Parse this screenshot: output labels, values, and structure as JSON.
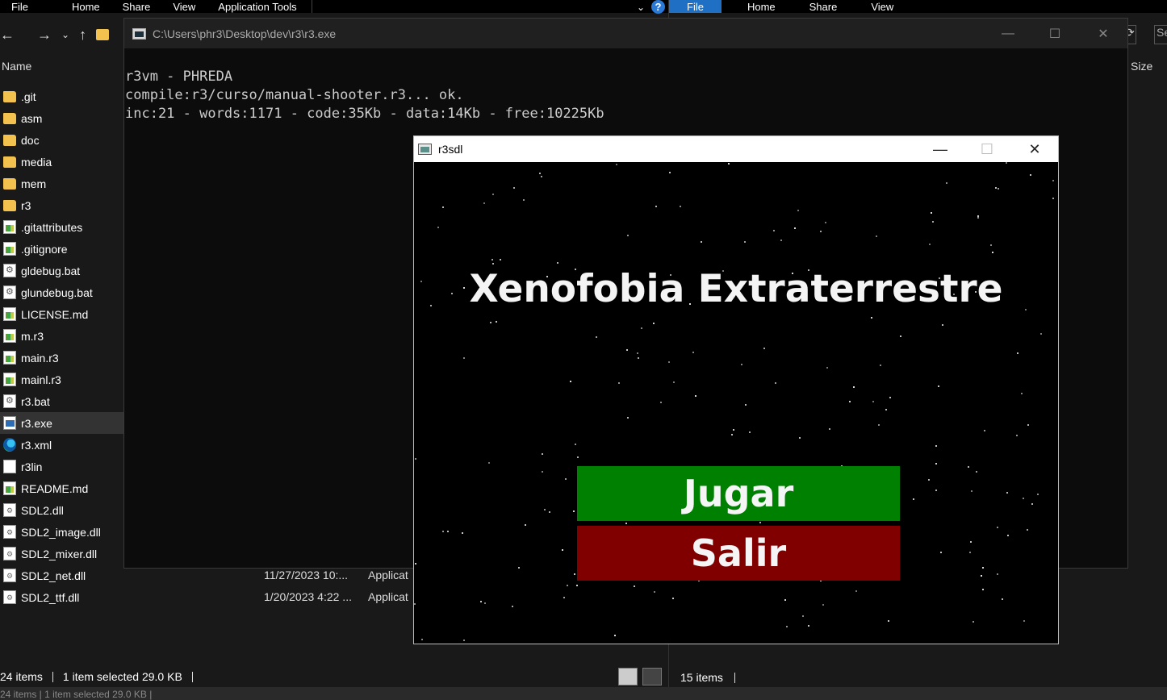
{
  "explorer_left": {
    "ribbon": [
      "File",
      "Home",
      "Share",
      "View",
      "Application Tools"
    ],
    "column_name": "Name",
    "files": [
      {
        "name": ".git",
        "icon": "folder-icon"
      },
      {
        "name": "asm",
        "icon": "folder-icon"
      },
      {
        "name": "doc",
        "icon": "folder-icon"
      },
      {
        "name": "media",
        "icon": "folder-icon"
      },
      {
        "name": "mem",
        "icon": "folder-icon"
      },
      {
        "name": "r3",
        "icon": "folder-icon"
      },
      {
        "name": ".gitattributes",
        "icon": "text-file-icon"
      },
      {
        "name": ".gitignore",
        "icon": "text-file-icon"
      },
      {
        "name": "gldebug.bat",
        "icon": "batch-file-icon"
      },
      {
        "name": "glundebug.bat",
        "icon": "batch-file-icon"
      },
      {
        "name": "LICENSE.md",
        "icon": "text-file-icon"
      },
      {
        "name": "m.r3",
        "icon": "text-file-icon"
      },
      {
        "name": "main.r3",
        "icon": "text-file-icon"
      },
      {
        "name": "mainl.r3",
        "icon": "text-file-icon"
      },
      {
        "name": "r3.bat",
        "icon": "batch-file-icon"
      },
      {
        "name": "r3.exe",
        "icon": "exe-file-icon",
        "selected": true
      },
      {
        "name": "r3.xml",
        "icon": "edge-icon"
      },
      {
        "name": "r3lin",
        "icon": "blank-file-icon"
      },
      {
        "name": "README.md",
        "icon": "text-file-icon"
      },
      {
        "name": "SDL2.dll",
        "icon": "dll-file-icon"
      },
      {
        "name": "SDL2_image.dll",
        "icon": "dll-file-icon"
      },
      {
        "name": "SDL2_mixer.dll",
        "icon": "dll-file-icon"
      },
      {
        "name": "SDL2_net.dll",
        "icon": "dll-file-icon"
      },
      {
        "name": "SDL2_ttf.dll",
        "icon": "dll-file-icon"
      }
    ],
    "details": [
      {
        "date": "11/27/2023 10:...",
        "type": "Applicat"
      },
      {
        "date": "1/20/2023 4:22 ...",
        "type": "Applicat"
      }
    ],
    "status": {
      "items": "24 items",
      "selected": "1 item selected  29.0 KB"
    },
    "ghost_status": "24 items  |  1 item selected  29.0 KB  |"
  },
  "explorer_right": {
    "ribbon": [
      "File",
      "Home",
      "Share",
      "View"
    ],
    "search_placeholder": "Se",
    "column_size": "Size",
    "status": "15 items"
  },
  "console": {
    "title": "C:\\Users\\phr3\\Desktop\\dev\\r3\\r3.exe",
    "lines": [
      "r3vm - PHREDA",
      "compile:r3/curso/manual-shooter.r3... ok.",
      "inc:21 - words:1171 - code:35Kb - data:14Kb - free:10225Kb"
    ]
  },
  "game": {
    "title": "r3sdl",
    "heading": "Xenofobia Extraterrestre",
    "play_label": "Jugar",
    "exit_label": "Salir",
    "colors": {
      "play": "#008000",
      "exit": "#800000",
      "background": "#000000"
    }
  }
}
